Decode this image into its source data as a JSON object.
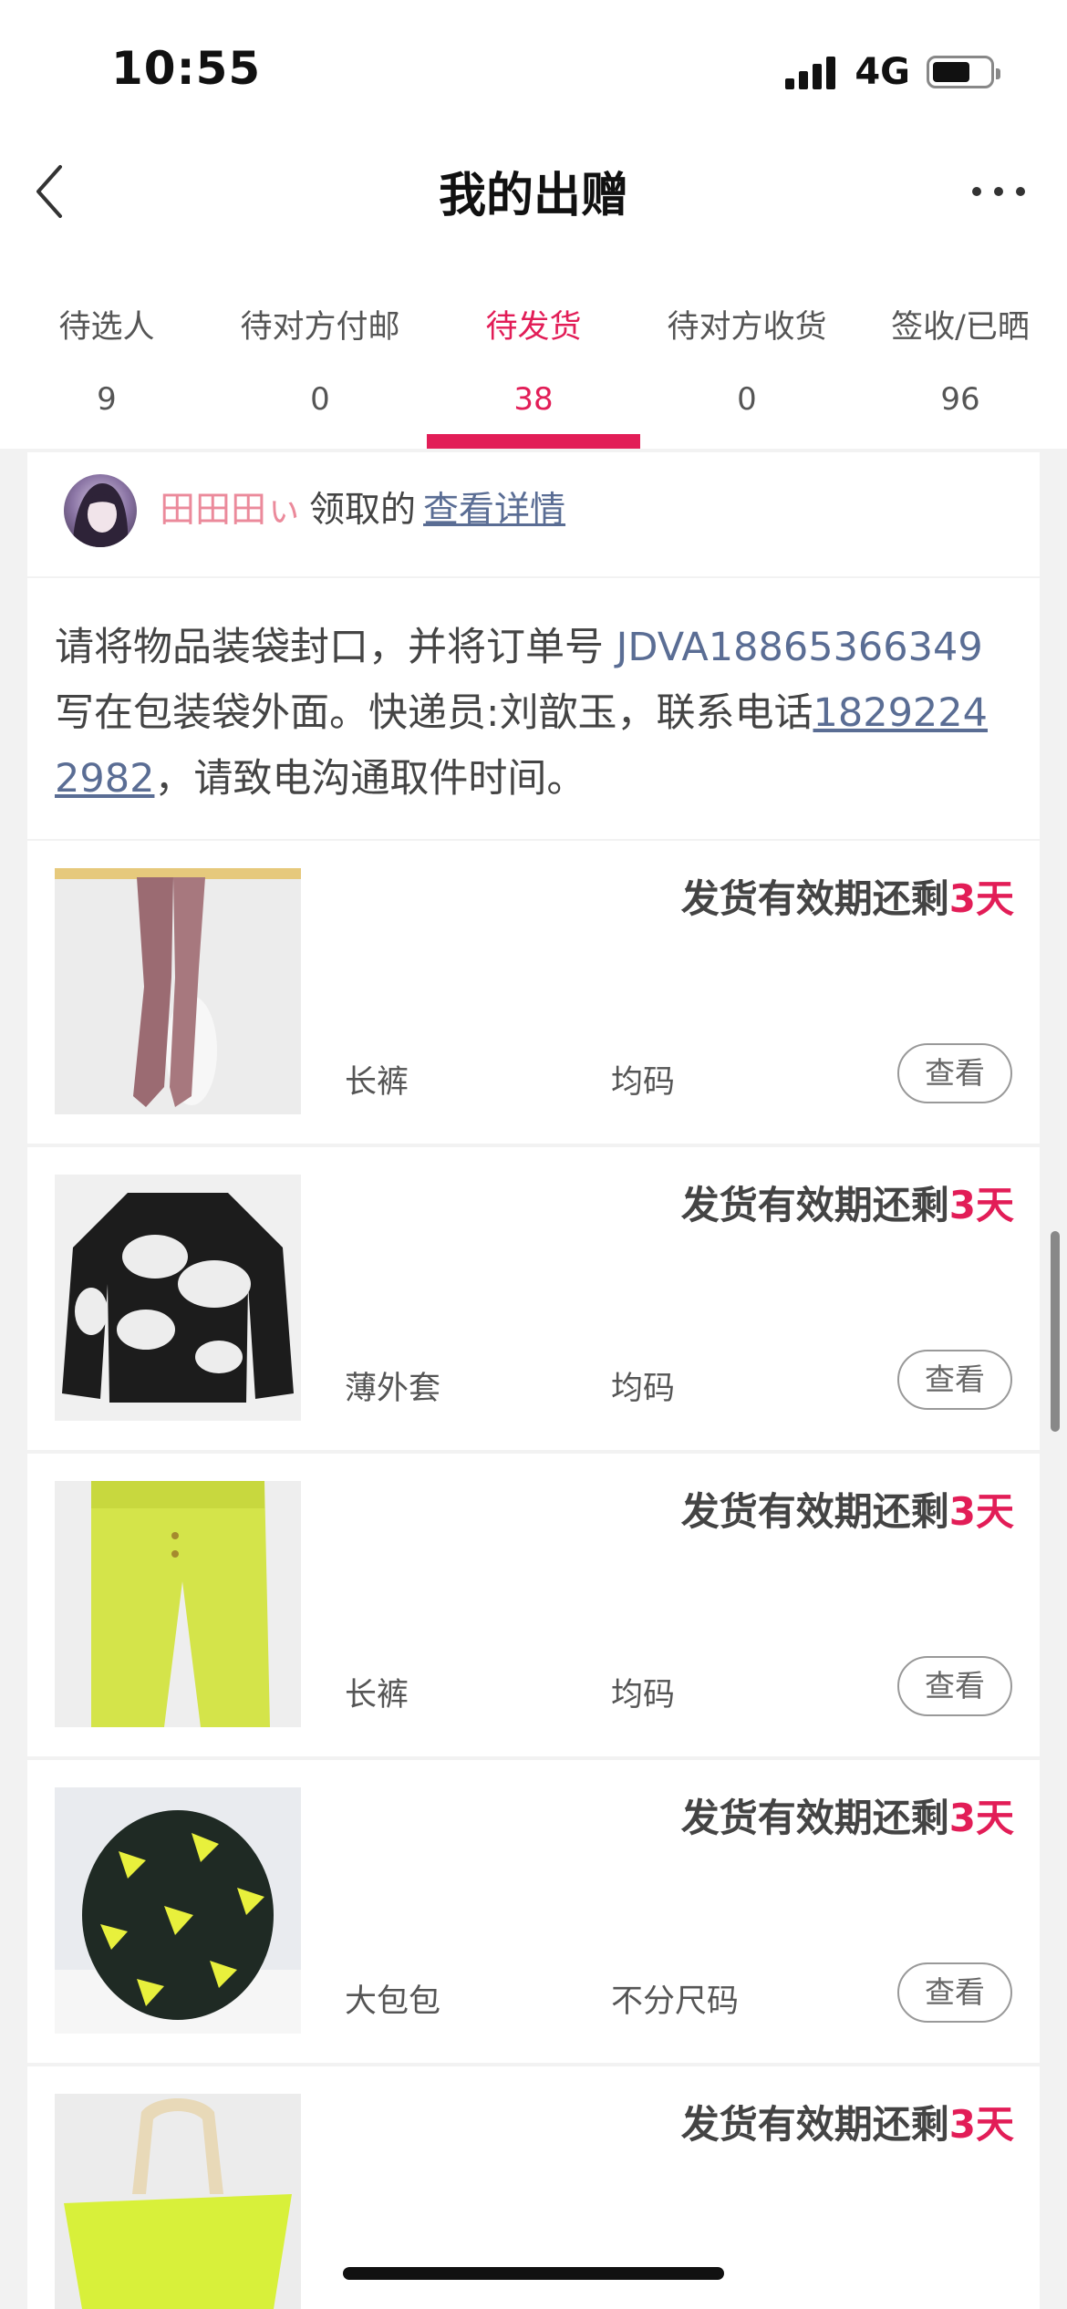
{
  "status_bar": {
    "time": "10:55",
    "network": "4G"
  },
  "nav": {
    "title": "我的出赠"
  },
  "tabs": [
    {
      "label": "待选人",
      "count": "9"
    },
    {
      "label": "待对方付邮",
      "count": "0"
    },
    {
      "label": "待发货",
      "count": "38",
      "active": true
    },
    {
      "label": "待对方收货",
      "count": "0"
    },
    {
      "label": "签收/已晒",
      "count": "96"
    }
  ],
  "giver": {
    "name": "田田田ぃ",
    "action": "领取的",
    "link": "查看详情"
  },
  "notice": {
    "pre": "请将物品装袋封口，并将订单号 ",
    "order_no": "JDVA18865366349",
    "mid": " 写在包装袋外面。快递员:刘歆玉，联系电话",
    "phone": "18292242982",
    "post": "，请致电沟通取件时间。"
  },
  "items": [
    {
      "deadline_prefix": "发货有效期还剩",
      "days": "3天",
      "category": "长裤",
      "size": "均码",
      "button": "查看"
    },
    {
      "deadline_prefix": "发货有效期还剩",
      "days": "3天",
      "category": "薄外套",
      "size": "均码",
      "button": "查看"
    },
    {
      "deadline_prefix": "发货有效期还剩",
      "days": "3天",
      "category": "长裤",
      "size": "均码",
      "button": "查看"
    },
    {
      "deadline_prefix": "发货有效期还剩",
      "days": "3天",
      "category": "大包包",
      "size": "不分尺码",
      "button": "查看"
    },
    {
      "deadline_prefix": "发货有效期还剩",
      "days": "3天",
      "category": "",
      "size": "",
      "button": ""
    }
  ],
  "colors": {
    "accent": "#e21d57",
    "link": "#5a6d94",
    "giver_name": "#eb8a9b"
  }
}
